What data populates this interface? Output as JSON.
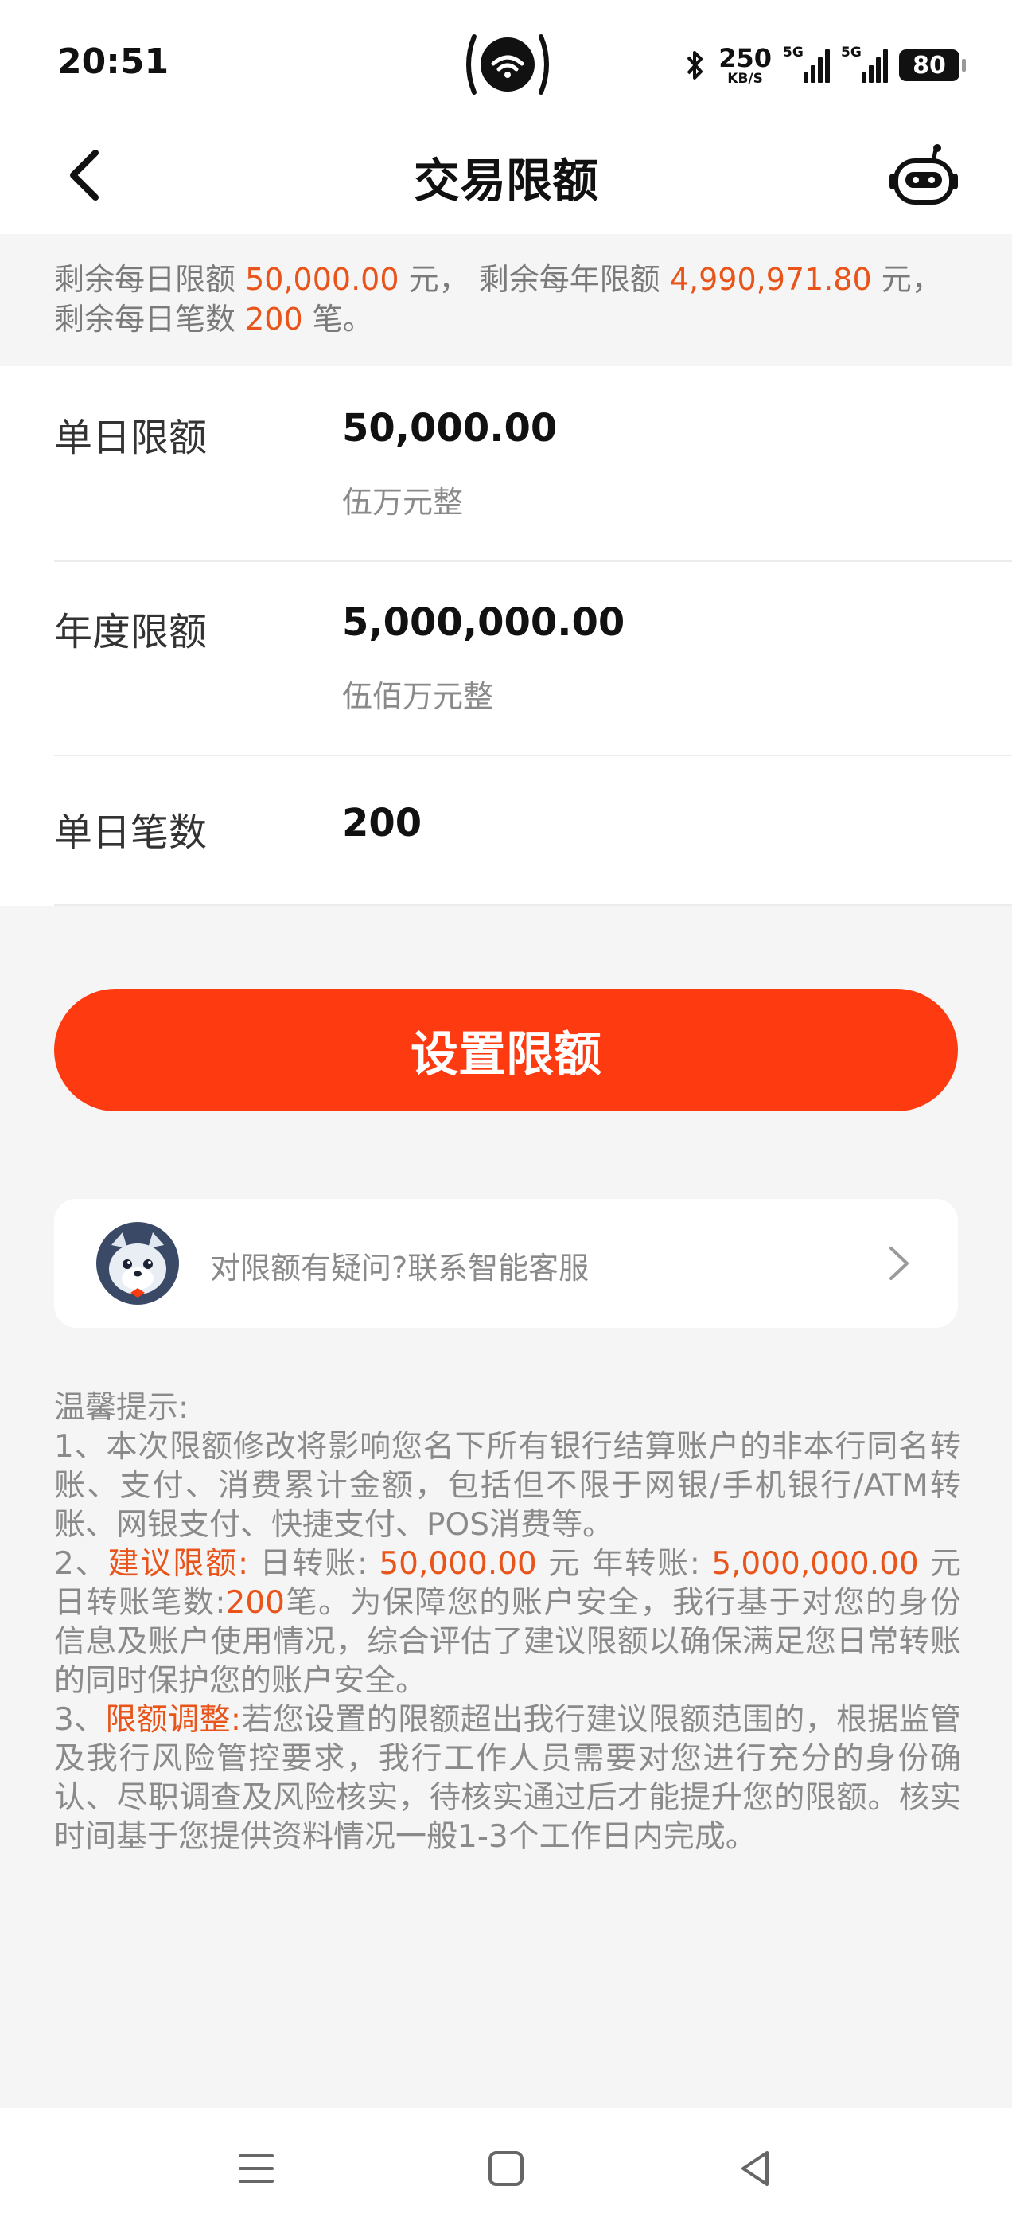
{
  "status_bar": {
    "time": "20:51",
    "network_speed": "250",
    "speed_unit": "KB/S",
    "signal1_label": "5G",
    "signal2_label": "5G",
    "battery": "80"
  },
  "nav": {
    "title": "交易限额",
    "back_icon": "chevron-left-icon",
    "assistant_icon": "robot-assistant-icon"
  },
  "summary": {
    "daily_label": "剩余每日限额",
    "daily_value": "50,000.00",
    "daily_unit": "元，",
    "yearly_label": "剩余每年限额",
    "yearly_value": "4,990,971.80",
    "yearly_unit": "元，",
    "count_label": "剩余每日笔数",
    "count_value": "200",
    "count_unit": "笔。"
  },
  "limits": {
    "daily": {
      "label": "单日限额",
      "value": "50,000.00",
      "uppercase": "伍万元整"
    },
    "yearly": {
      "label": "年度限额",
      "value": "5,000,000.00",
      "uppercase": "伍佰万元整"
    },
    "count": {
      "label": "单日笔数",
      "value": "200"
    }
  },
  "actions": {
    "set_limit_label": "设置限额"
  },
  "help": {
    "text": "对限额有疑问?联系智能客服"
  },
  "tips": {
    "heading": "温馨提示:",
    "item1": "1、本次限额修改将影响您名下所有银行结算账户的非本行同名转账、支付、消费累计金额，包括但不限于网银/手机银行/ATM转账、网银支付、快捷支付、POS消费等。",
    "item2_prefix": "2、",
    "item2_title": "建议限额:",
    "item2_day_label": " 日转账: ",
    "item2_day_value": "50,000.00",
    "item2_year_label": " 元 年转账: ",
    "item2_year_value": "5,000,000.00",
    "item2_count_label": " 元 日转账笔数:",
    "item2_count_value": "200",
    "item2_rest": "笔。为保障您的账户安全，我行基于对您的身份信息及账户使用情况，综合评估了建议限额以确保满足您日常转账的同时保护您的账户安全。",
    "item3_prefix": "3、",
    "item3_title": "限额调整:",
    "item3_rest": "若您设置的限额超出我行建议限额范围的，根据监管及我行风险管控要求，我行工作人员需要对您进行充分的身份确认、尽职调查及风险核实，待核实通过后才能提升您的限额。核实时间基于您提供资料情况一般1-3个工作日内完成。"
  },
  "colors": {
    "accent": "#fd3a10",
    "highlight": "#e8541a"
  }
}
